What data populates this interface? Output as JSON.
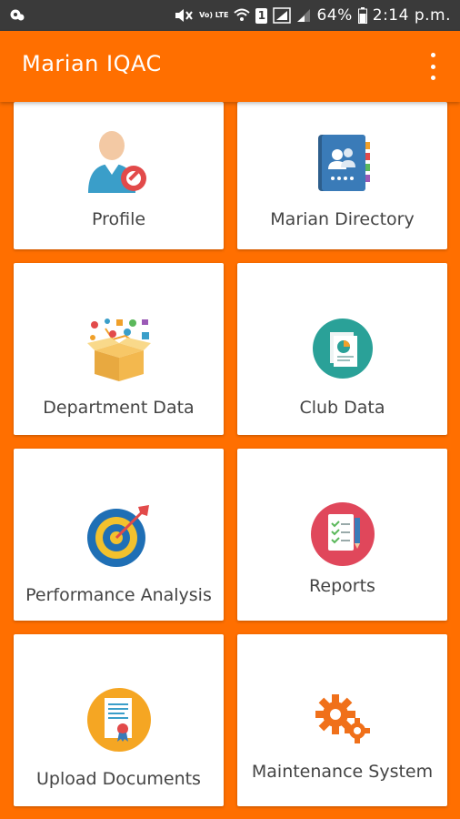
{
  "status_bar": {
    "battery_percent": "64%",
    "sim_slot": "1",
    "network_badge": "Vo) LTE",
    "time": "2:14 p.m."
  },
  "app_bar": {
    "title": "Marian IQAC",
    "menu_icon": "more-vert-icon"
  },
  "colors": {
    "primary": "#ff6f00",
    "status_bar": "#3a3a3a",
    "card": "#ffffff",
    "label_text": "#444444"
  },
  "tiles": [
    {
      "id": "profile",
      "label": "Profile",
      "icon": "profile-user-icon"
    },
    {
      "id": "marian-directory",
      "label": "Marian Directory",
      "icon": "address-book-icon"
    },
    {
      "id": "department-data",
      "label": "Department Data",
      "icon": "department-box-icon"
    },
    {
      "id": "club-data",
      "label": "Club Data",
      "icon": "pie-chart-document-icon"
    },
    {
      "id": "performance-analysis",
      "label": "Performance Analysis",
      "icon": "target-icon"
    },
    {
      "id": "reports",
      "label": "Reports",
      "icon": "checklist-report-icon"
    },
    {
      "id": "upload-documents",
      "label": "Upload Documents",
      "icon": "certificate-document-icon"
    },
    {
      "id": "maintenance-system",
      "label": "Maintenance System",
      "icon": "gears-icon"
    }
  ]
}
